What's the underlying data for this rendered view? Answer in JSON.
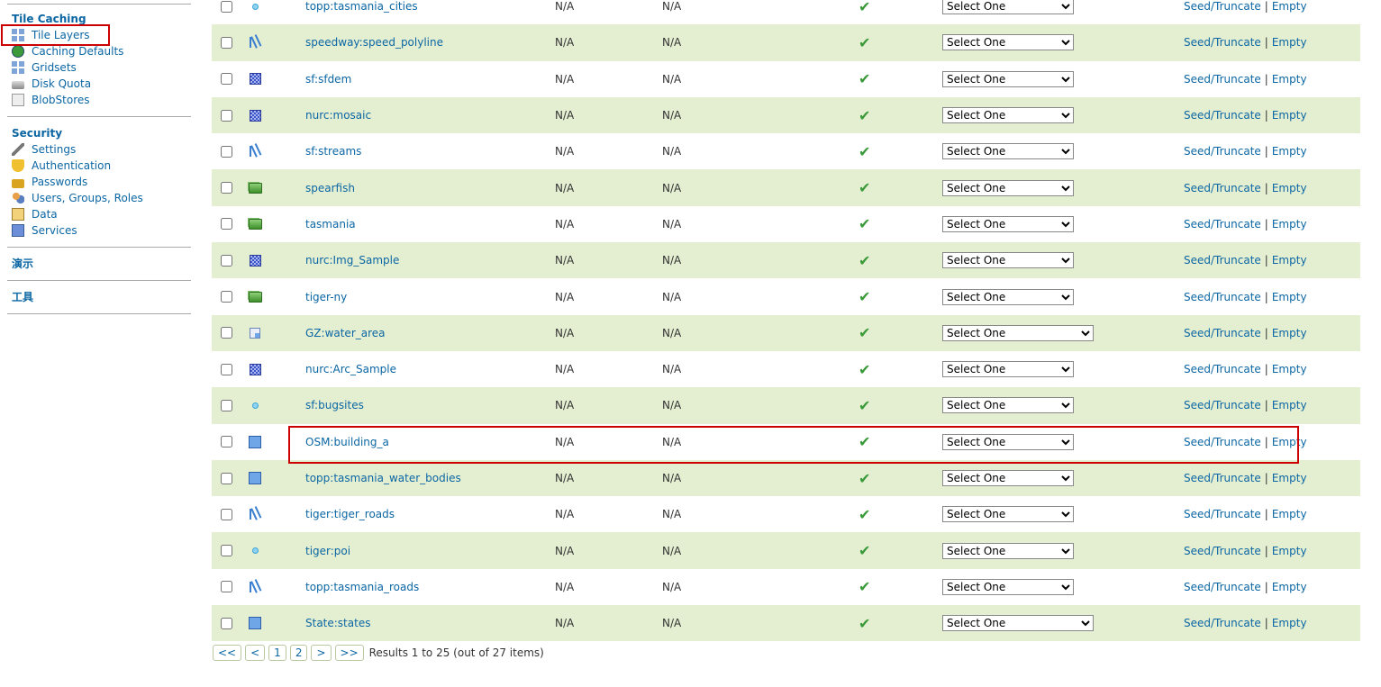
{
  "sidebar": {
    "tile_caching": {
      "title": "Tile Caching",
      "items": [
        {
          "label": "Tile Layers",
          "icon": "tile-layers-icon"
        },
        {
          "label": "Caching Defaults",
          "icon": "globe-icon"
        },
        {
          "label": "Gridsets",
          "icon": "grid-icon"
        },
        {
          "label": "Disk Quota",
          "icon": "disk-icon"
        },
        {
          "label": "BlobStores",
          "icon": "blobstore-icon"
        }
      ]
    },
    "security": {
      "title": "Security",
      "items": [
        {
          "label": "Settings",
          "icon": "wrench-icon"
        },
        {
          "label": "Authentication",
          "icon": "shield-icon"
        },
        {
          "label": "Passwords",
          "icon": "lock-icon"
        },
        {
          "label": "Users, Groups, Roles",
          "icon": "users-icon"
        },
        {
          "label": "Data",
          "icon": "data-icon"
        },
        {
          "label": "Services",
          "icon": "services-icon"
        }
      ]
    },
    "demos_title": "演示",
    "tools_title": "工具"
  },
  "table": {
    "rows": [
      {
        "type": "point",
        "name": "topp:tasmania_cities",
        "col1": "N/A",
        "col2": "N/A",
        "select": "Select One"
      },
      {
        "type": "line",
        "name": "speedway:speed_polyline",
        "col1": "N/A",
        "col2": "N/A",
        "select": "Select One"
      },
      {
        "type": "raster",
        "name": "sf:sfdem",
        "col1": "N/A",
        "col2": "N/A",
        "select": "Select One"
      },
      {
        "type": "raster",
        "name": "nurc:mosaic",
        "col1": "N/A",
        "col2": "N/A",
        "select": "Select One"
      },
      {
        "type": "line",
        "name": "sf:streams",
        "col1": "N/A",
        "col2": "N/A",
        "select": "Select One"
      },
      {
        "type": "group",
        "name": "spearfish",
        "col1": "N/A",
        "col2": "N/A",
        "select": "Select One"
      },
      {
        "type": "group",
        "name": "tasmania",
        "col1": "N/A",
        "col2": "N/A",
        "select": "Select One"
      },
      {
        "type": "raster",
        "name": "nurc:Img_Sample",
        "col1": "N/A",
        "col2": "N/A",
        "select": "Select One"
      },
      {
        "type": "group",
        "name": "tiger-ny",
        "col1": "N/A",
        "col2": "N/A",
        "select": "Select One"
      },
      {
        "type": "polygon-s",
        "name": "GZ:water_area",
        "col1": "N/A",
        "col2": "N/A",
        "select": "Select One",
        "wide": true
      },
      {
        "type": "raster",
        "name": "nurc:Arc_Sample",
        "col1": "N/A",
        "col2": "N/A",
        "select": "Select One"
      },
      {
        "type": "point",
        "name": "sf:bugsites",
        "col1": "N/A",
        "col2": "N/A",
        "select": "Select One"
      },
      {
        "type": "polygon",
        "name": "OSM:building_a",
        "col1": "N/A",
        "col2": "N/A",
        "select": "Select One"
      },
      {
        "type": "polygon",
        "name": "topp:tasmania_water_bodies",
        "col1": "N/A",
        "col2": "N/A",
        "select": "Select One"
      },
      {
        "type": "line",
        "name": "tiger:tiger_roads",
        "col1": "N/A",
        "col2": "N/A",
        "select": "Select One"
      },
      {
        "type": "point",
        "name": "tiger:poi",
        "col1": "N/A",
        "col2": "N/A",
        "select": "Select One"
      },
      {
        "type": "line",
        "name": "topp:tasmania_roads",
        "col1": "N/A",
        "col2": "N/A",
        "select": "Select One"
      },
      {
        "type": "polygon",
        "name": "State:states",
        "col1": "N/A",
        "col2": "N/A",
        "select": "Select One",
        "wide": true
      }
    ],
    "enabled_mark": "✔",
    "seed_label": "Seed/Truncate",
    "separator": "|",
    "empty_label": "Empty"
  },
  "pager": {
    "first": "<<",
    "prev": "<",
    "pages": [
      "1",
      "2"
    ],
    "next": ">",
    "last": ">>",
    "info": "Results 1 to 25 (out of 27 items)"
  },
  "colors": {
    "link": "#0b66a3",
    "row_alt": "#e4efd2",
    "highlight": "#cc0000",
    "check": "#3a9a3a"
  }
}
